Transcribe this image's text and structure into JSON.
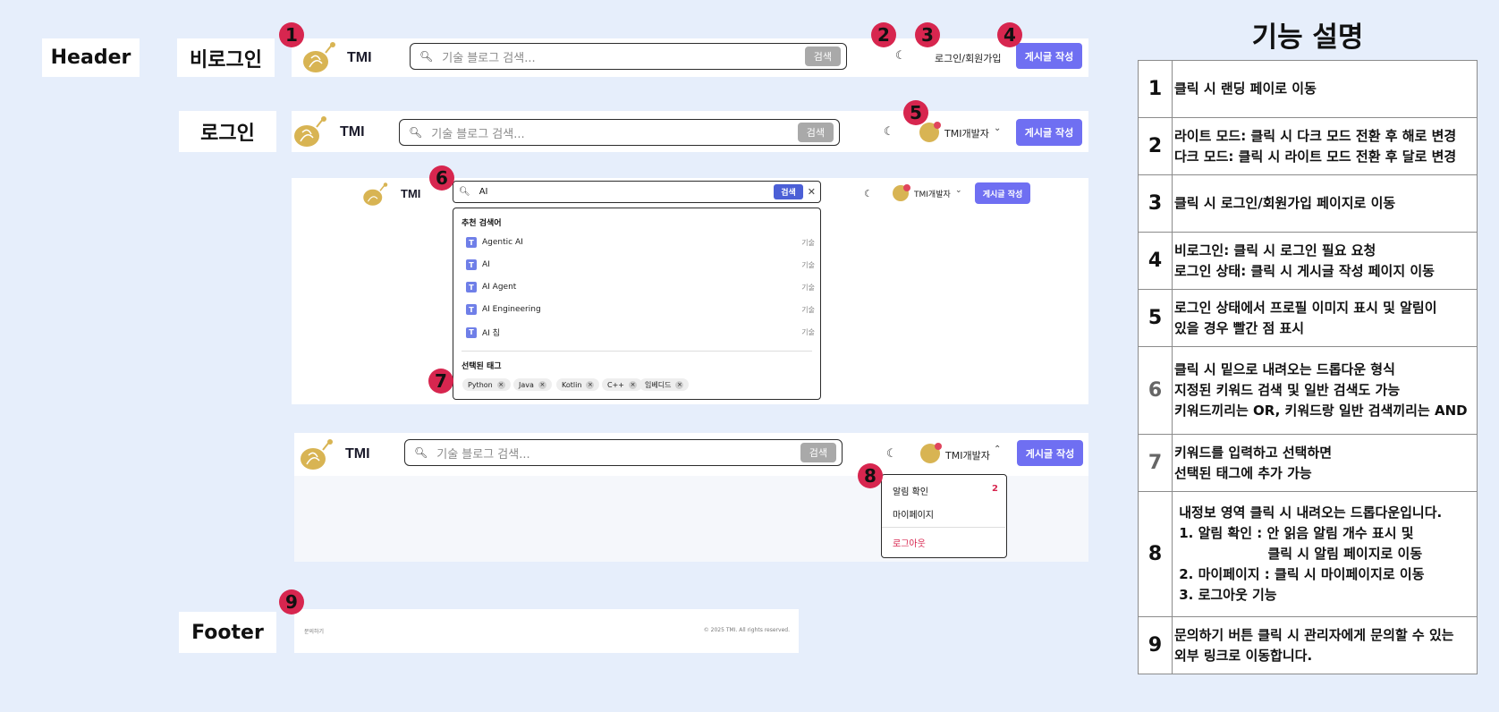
{
  "labels": {
    "header": "Header",
    "logged_out": "비로그인",
    "logged_in": "로그인",
    "footer": "Footer"
  },
  "badges": [
    "1",
    "2",
    "3",
    "4",
    "5",
    "6",
    "7",
    "8",
    "9"
  ],
  "header": {
    "brand": "TMI",
    "search_placeholder": "기술 블로그 검색...",
    "search_button": "검색",
    "login_signup": "로그인/회원가입",
    "write_button": "게시글 작성",
    "username": "TMI개발자"
  },
  "search_dropdown": {
    "query": "AI",
    "search_button": "검색",
    "recommended_title": "추천 검색어",
    "suggestions": [
      {
        "icon": "T",
        "text": "Agentic AI",
        "tag": "기술"
      },
      {
        "icon": "T",
        "text": "AI",
        "tag": "기술"
      },
      {
        "icon": "T",
        "text": "AI Agent",
        "tag": "기술"
      },
      {
        "icon": "T",
        "text": "AI Engineering",
        "tag": "기술"
      },
      {
        "icon": "T",
        "text": "AI 칩",
        "tag": "기술"
      }
    ],
    "selected_title": "선택된 태그",
    "tags": [
      "Python",
      "Java",
      "Kotlin",
      "C++",
      "임베디드"
    ]
  },
  "user_menu": {
    "notifications": "알림 확인",
    "notification_count": "2",
    "mypage": "마이페이지",
    "logout": "로그아웃"
  },
  "footer": {
    "contact": "문의하기",
    "copyright": "© 2025 TMI. All rights reserved."
  },
  "feature_panel": {
    "title": "기능 설명",
    "rows": [
      {
        "num": "1",
        "lines": [
          "클릭 시 랜딩 페이로 이동"
        ]
      },
      {
        "num": "2",
        "lines": [
          "라이트 모드: 클릭 시 다크 모드 전환 후 해로 변경",
          "다크 모드:  클릭 시 라이트 모드 전환 후 달로 변경"
        ]
      },
      {
        "num": "3",
        "lines": [
          "클릭 시 로그인/회원가입 페이지로 이동"
        ]
      },
      {
        "num": "4",
        "lines": [
          "비로그인:  클릭 시 로그인 필요 요청",
          "로그인 상태: 클릭 시 게시글 작성 페이지 이동"
        ]
      },
      {
        "num": "5",
        "lines": [
          "로그인 상태에서 프로필 이미지 표시 및 알림이",
          "있을 경우 빨간 점 표시"
        ]
      },
      {
        "num": "6",
        "lines": [
          "클릭 시 밑으로 내려오는 드롭다운 형식",
          "지정된 키워드 검색 및 일반 검색도 가능",
          "키워드끼리는 OR, 키워드랑 일반 검색끼리는 AND"
        ]
      },
      {
        "num": "7",
        "lines": [
          "키워드를 입력하고 선택하면",
          "선택된 태그에 추가 가능"
        ]
      },
      {
        "num": "8",
        "lines": [
          " 내정보 영역 클릭 시 내려오는 드롭다운입니다.",
          " 1. 알림 확인 : 안 읽음 알림 개수 표시 및",
          "                    클릭 시 알림 페이지로 이동",
          " 2. 마이페이지 : 클릭 시 마이페이지로 이동",
          " 3. 로그아웃 기능"
        ]
      },
      {
        "num": "9",
        "lines": [
          "문의하기 버튼 클릭 시 관리자에게 문의할 수 있는",
          "외부 링크로 이동합니다."
        ]
      }
    ]
  }
}
